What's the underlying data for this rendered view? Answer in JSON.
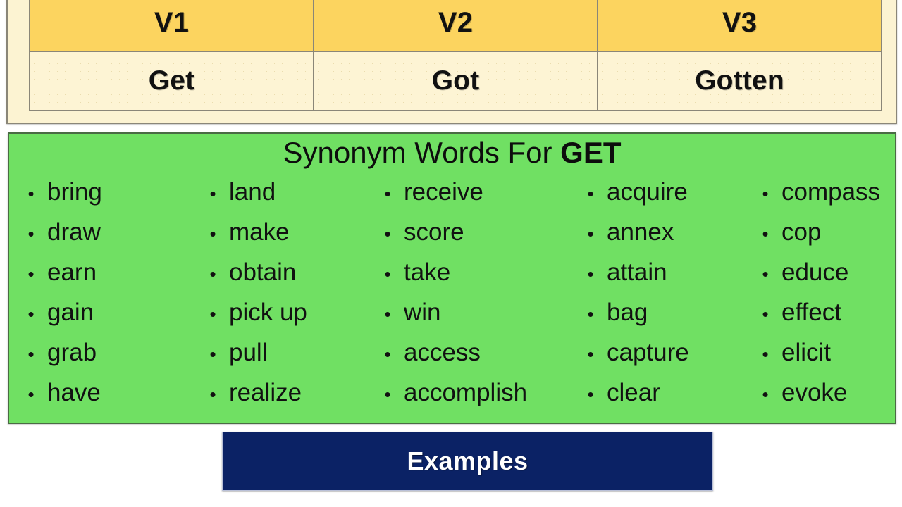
{
  "verb_table": {
    "headers": [
      "V1",
      "V2",
      "V3"
    ],
    "forms": [
      "Get",
      "Got",
      "Gotten"
    ],
    "header_bg": "#fcd45f",
    "body_bg": "#fdf4d4",
    "border_color": "#8a8678"
  },
  "synonyms": {
    "title_prefix": "Synonym Words For ",
    "title_keyword": "GET",
    "panel_bg": "#70e063",
    "bullet_glyph": "•",
    "columns": [
      {
        "items": [
          "bring",
          "draw",
          "earn",
          "gain",
          "grab",
          "have"
        ]
      },
      {
        "items": [
          "land",
          "make",
          "obtain",
          "pick up",
          "pull",
          "realize"
        ]
      },
      {
        "items": [
          "receive",
          "score",
          "take",
          "win",
          "access",
          "accomplish"
        ]
      },
      {
        "items": [
          "acquire",
          "annex",
          "attain",
          "bag",
          "capture",
          "clear"
        ]
      },
      {
        "items": [
          "compass",
          "cop",
          "educe",
          "effect",
          "elicit",
          "evoke"
        ]
      }
    ]
  },
  "examples_bar": {
    "label": "Examples",
    "bg": "#0b2265",
    "text_color": "#ffffff"
  }
}
